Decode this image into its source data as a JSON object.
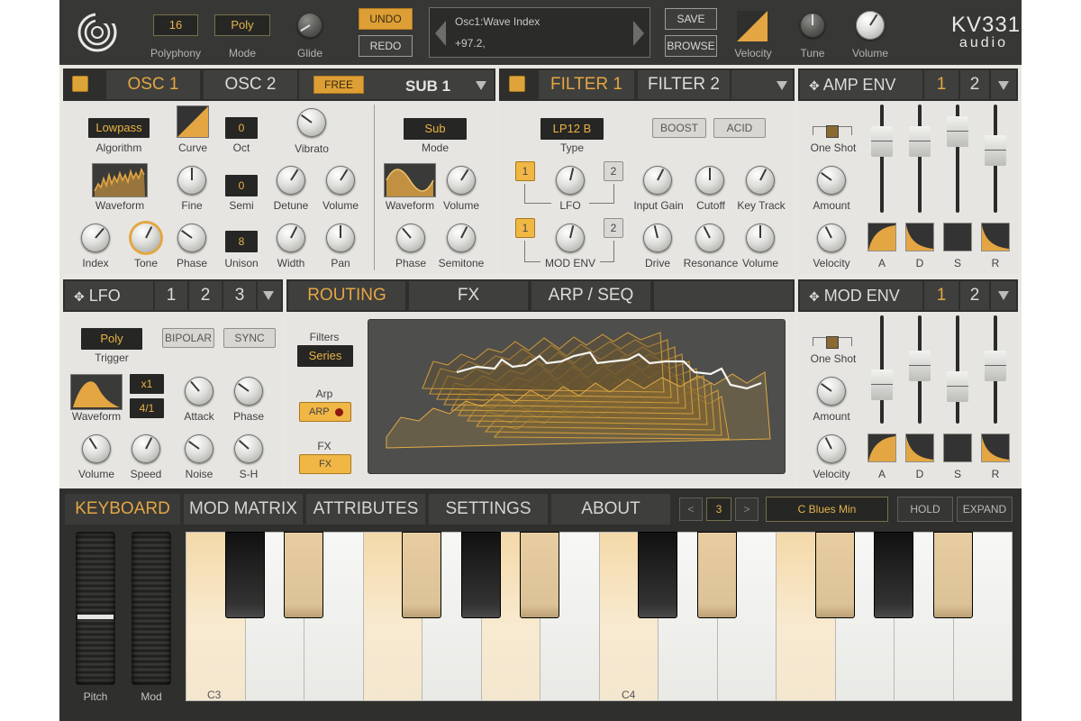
{
  "colors": {
    "accent": "#e4a642",
    "panel": "#e6e5e1",
    "dark": "#373735"
  },
  "top": {
    "logo_icon": "ring-logo-icon",
    "polyphony_value": "16",
    "polyphony_label": "Polyphony",
    "mode_value": "Poly",
    "mode_label": "Mode",
    "glide_label": "Glide",
    "undo_label": "UNDO",
    "redo_label": "REDO",
    "display_title": "Osc1:Wave Index",
    "display_value": "+97.2,",
    "save_label": "SAVE",
    "browse_label": "BROWSE",
    "velocity_label": "Velocity",
    "tune_label": "Tune",
    "volume_label": "Volume",
    "brand_main": "KV331",
    "brand_sub": "audio"
  },
  "osc": {
    "tabs": [
      "OSC 1",
      "OSC 2"
    ],
    "free_label": "FREE",
    "sub_tab": "SUB 1",
    "algorithm_value": "Lowpass",
    "algorithm_label": "Algorithm",
    "curve_label": "Curve",
    "oct_value": "0",
    "oct_label": "Oct",
    "vibrato_label": "Vibrato",
    "waveform_label": "Waveform",
    "fine_label": "Fine",
    "semi_value": "0",
    "semi_label": "Semi",
    "detune_label": "Detune",
    "volume_label": "Volume",
    "index_label": "Index",
    "tone_label": "Tone",
    "phase_label": "Phase",
    "unison_value": "8",
    "unison_label": "Unison",
    "width_label": "Width",
    "pan_label": "Pan",
    "sub_mode_value": "Sub",
    "sub_mode_label": "Mode",
    "sub_waveform_label": "Waveform",
    "sub_volume_label": "Volume",
    "sub_phase_label": "Phase",
    "sub_semitone_label": "Semitone"
  },
  "filter": {
    "tabs": [
      "FILTER 1",
      "FILTER 2"
    ],
    "type_value": "LP12 B",
    "type_label": "Type",
    "boost_label": "BOOST",
    "acid_label": "ACID",
    "lfo_btn1": "1",
    "lfo_btn2": "2",
    "lfo_label": "LFO",
    "input_gain_label": "Input Gain",
    "cutoff_label": "Cutoff",
    "key_track_label": "Key Track",
    "modenv_btn1": "1",
    "modenv_btn2": "2",
    "mod_env_label": "MOD ENV",
    "drive_label": "Drive",
    "resonance_label": "Resonance",
    "volume_label": "Volume"
  },
  "amp_env": {
    "title": "AMP ENV",
    "tab1": "1",
    "tab2": "2",
    "one_shot_label": "One Shot",
    "amount_label": "Amount",
    "velocity_label": "Velocity",
    "stages": [
      "A",
      "D",
      "S",
      "R"
    ],
    "levels": [
      0.72,
      0.72,
      0.85,
      0.6
    ]
  },
  "lfo": {
    "title": "LFO",
    "tabs": [
      "1",
      "2",
      "3"
    ],
    "trigger_value": "Poly",
    "trigger_label": "Trigger",
    "bipolar_label": "BIPOLAR",
    "sync_label": "SYNC",
    "mult_value": "x1",
    "rate_value": "4/1",
    "waveform_label": "Waveform",
    "attack_label": "Attack",
    "phase_label": "Phase",
    "volume_label": "Volume",
    "speed_label": "Speed",
    "noise_label": "Noise",
    "sh_label": "S-H"
  },
  "routing": {
    "tabs": [
      "ROUTING",
      "FX",
      "ARP / SEQ"
    ],
    "filters_label": "Filters",
    "filters_value": "Series",
    "arp_label": "Arp",
    "arp_button": "ARP",
    "fx_label": "FX",
    "fx_button": "FX"
  },
  "mod_env": {
    "title": "MOD ENV",
    "tab1": "1",
    "tab2": "2",
    "one_shot_label": "One Shot",
    "amount_label": "Amount",
    "velocity_label": "Velocity",
    "stages": [
      "A",
      "D",
      "S",
      "R"
    ],
    "levels": [
      0.3,
      0.55,
      0.28,
      0.55
    ]
  },
  "bottom": {
    "tabs": [
      "KEYBOARD",
      "MOD MATRIX",
      "ATTRIBUTES",
      "SETTINGS",
      "ABOUT"
    ],
    "prev": "<",
    "octave": "3",
    "next": ">",
    "scale": "C Blues Min",
    "hold": "HOLD",
    "expand": "EXPAND",
    "pitch_label": "Pitch",
    "mod_label": "Mod",
    "key_c3": "C3",
    "key_c4": "C4"
  },
  "knobs": {
    "glide": 0.05,
    "tune": 0.5,
    "volume": 0.62,
    "vibrato": 0.3,
    "fine": 0.5,
    "detune": 0.62,
    "osc_volume": 0.62,
    "index": 0.65,
    "tone": 0.6,
    "phase": 0.3,
    "width": 0.6,
    "pan": 0.5,
    "sub_volume": 0.62,
    "sub_phase": 0.35,
    "sub_semitone": 0.6,
    "lfo_f": 0.55,
    "input_gain": 0.6,
    "cutoff": 0.5,
    "key_track": 0.6,
    "modenv_f": 0.55,
    "drive": 0.45,
    "resonance": 0.4,
    "f_volume": 0.5,
    "amp_amount": 0.3,
    "amp_velocity": 0.4,
    "lfo_attack": 0.35,
    "lfo_phase": 0.3,
    "lfo_volume": 0.38,
    "lfo_speed": 0.6,
    "lfo_noise": 0.3,
    "lfo_sh": 0.32,
    "mod_amount": 0.3,
    "mod_velocity": 0.4
  }
}
